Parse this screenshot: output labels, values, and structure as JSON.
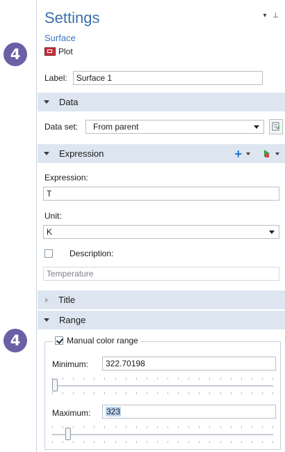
{
  "badges": {
    "top": "4",
    "bottom": "4"
  },
  "header": {
    "title": "Settings",
    "controls": "▾ ⊥",
    "subtitle": "Surface",
    "plot_button": "Plot"
  },
  "label_field": {
    "label": "Label:",
    "value": "Surface 1"
  },
  "sections": {
    "data": "Data",
    "expression": "Expression",
    "title": "Title",
    "range": "Range"
  },
  "data_set": {
    "label": "Data set:",
    "value": "From parent"
  },
  "expression": {
    "expression_label": "Expression:",
    "expression_value": "T",
    "unit_label": "Unit:",
    "unit_value": "K",
    "description_label": "Description:",
    "description_checked": false,
    "description_value": "Temperature"
  },
  "range": {
    "manual_label": "Manual color range",
    "manual_checked": true,
    "min_label": "Minimum:",
    "min_value": "322.70198",
    "min_slider_fraction": 0.0,
    "max_label": "Maximum:",
    "max_value": "323",
    "max_slider_fraction": 0.06
  },
  "colors": {
    "accent": "#3b6fa8",
    "section_bg": "#dde6f0",
    "badge": "#6b5fa6"
  }
}
